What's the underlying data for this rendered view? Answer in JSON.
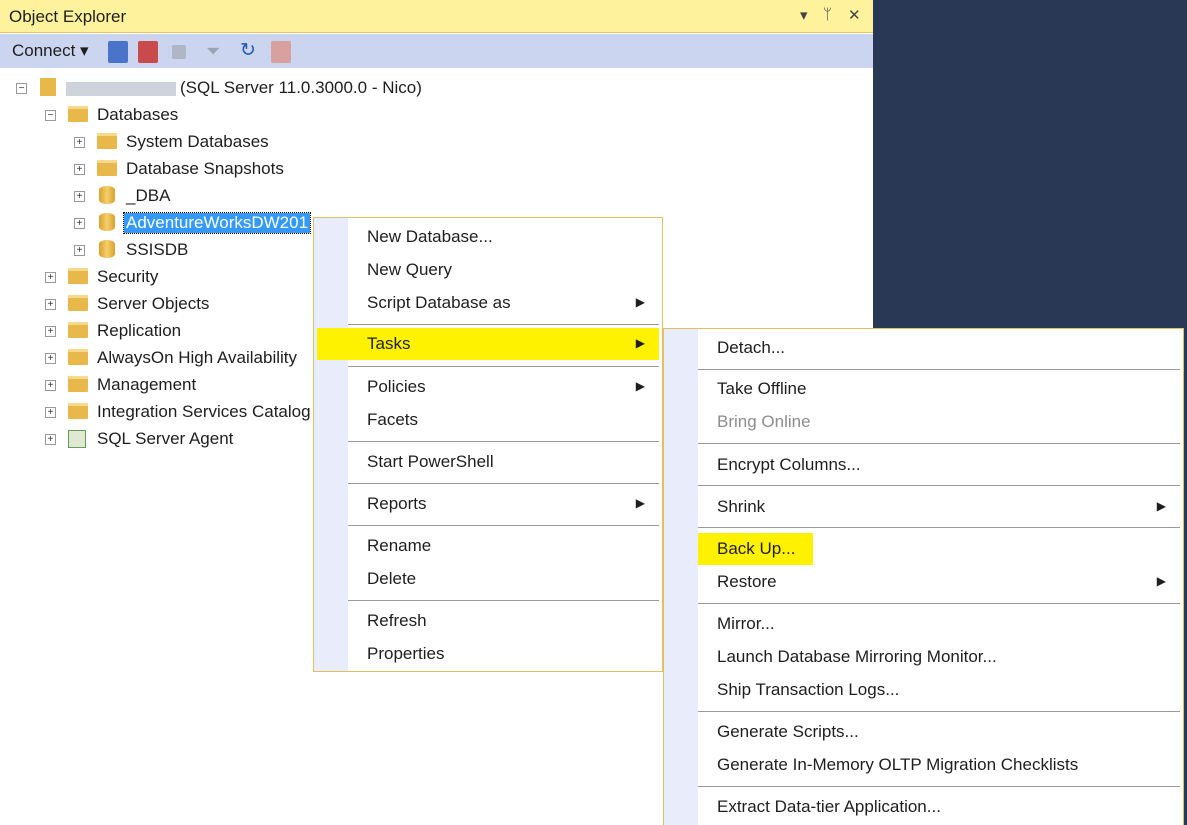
{
  "panel": {
    "title": "Object Explorer",
    "title_controls": [
      "▾",
      "ᛘ",
      "✕"
    ],
    "toolbar": {
      "connect_label": "Connect ▾"
    }
  },
  "tree": {
    "server": {
      "name_suffix": "(SQL Server 11.0.3000.0 - Nico)"
    },
    "databases": "Databases",
    "system_databases": "System Databases",
    "database_snapshots": "Database Snapshots",
    "dba": "_DBA",
    "adventureworks": "AdventureWorksDW201",
    "ssisdb": "SSISDB",
    "security": "Security",
    "server_objects": "Server Objects",
    "replication": "Replication",
    "alwayson": "AlwaysOn High Availability",
    "management": "Management",
    "integration": "Integration Services Catalog",
    "agent": "SQL Server Agent"
  },
  "context_menu": {
    "new_database": "New Database...",
    "new_query": "New Query",
    "script_database_as": "Script Database as",
    "tasks": "Tasks",
    "policies": "Policies",
    "facets": "Facets",
    "start_powershell": "Start PowerShell",
    "reports": "Reports",
    "rename": "Rename",
    "delete": "Delete",
    "refresh": "Refresh",
    "properties": "Properties"
  },
  "tasks_menu": {
    "detach": "Detach...",
    "take_offline": "Take Offline",
    "bring_online": "Bring Online",
    "encrypt_columns": "Encrypt Columns...",
    "shrink": "Shrink",
    "back_up": "Back Up...",
    "restore": "Restore",
    "mirror": "Mirror...",
    "launch_mirroring_monitor": "Launch Database Mirroring Monitor...",
    "ship_transaction_logs": "Ship Transaction Logs...",
    "generate_scripts": "Generate Scripts...",
    "generate_inmemory": "Generate In-Memory OLTP Migration Checklists",
    "extract_dac": "Extract Data-tier Application..."
  },
  "colors": {
    "highlight": "#fff200",
    "selection": "#3399ff",
    "toolbar": "#ccd5f0",
    "titlebar": "#fff29d"
  }
}
